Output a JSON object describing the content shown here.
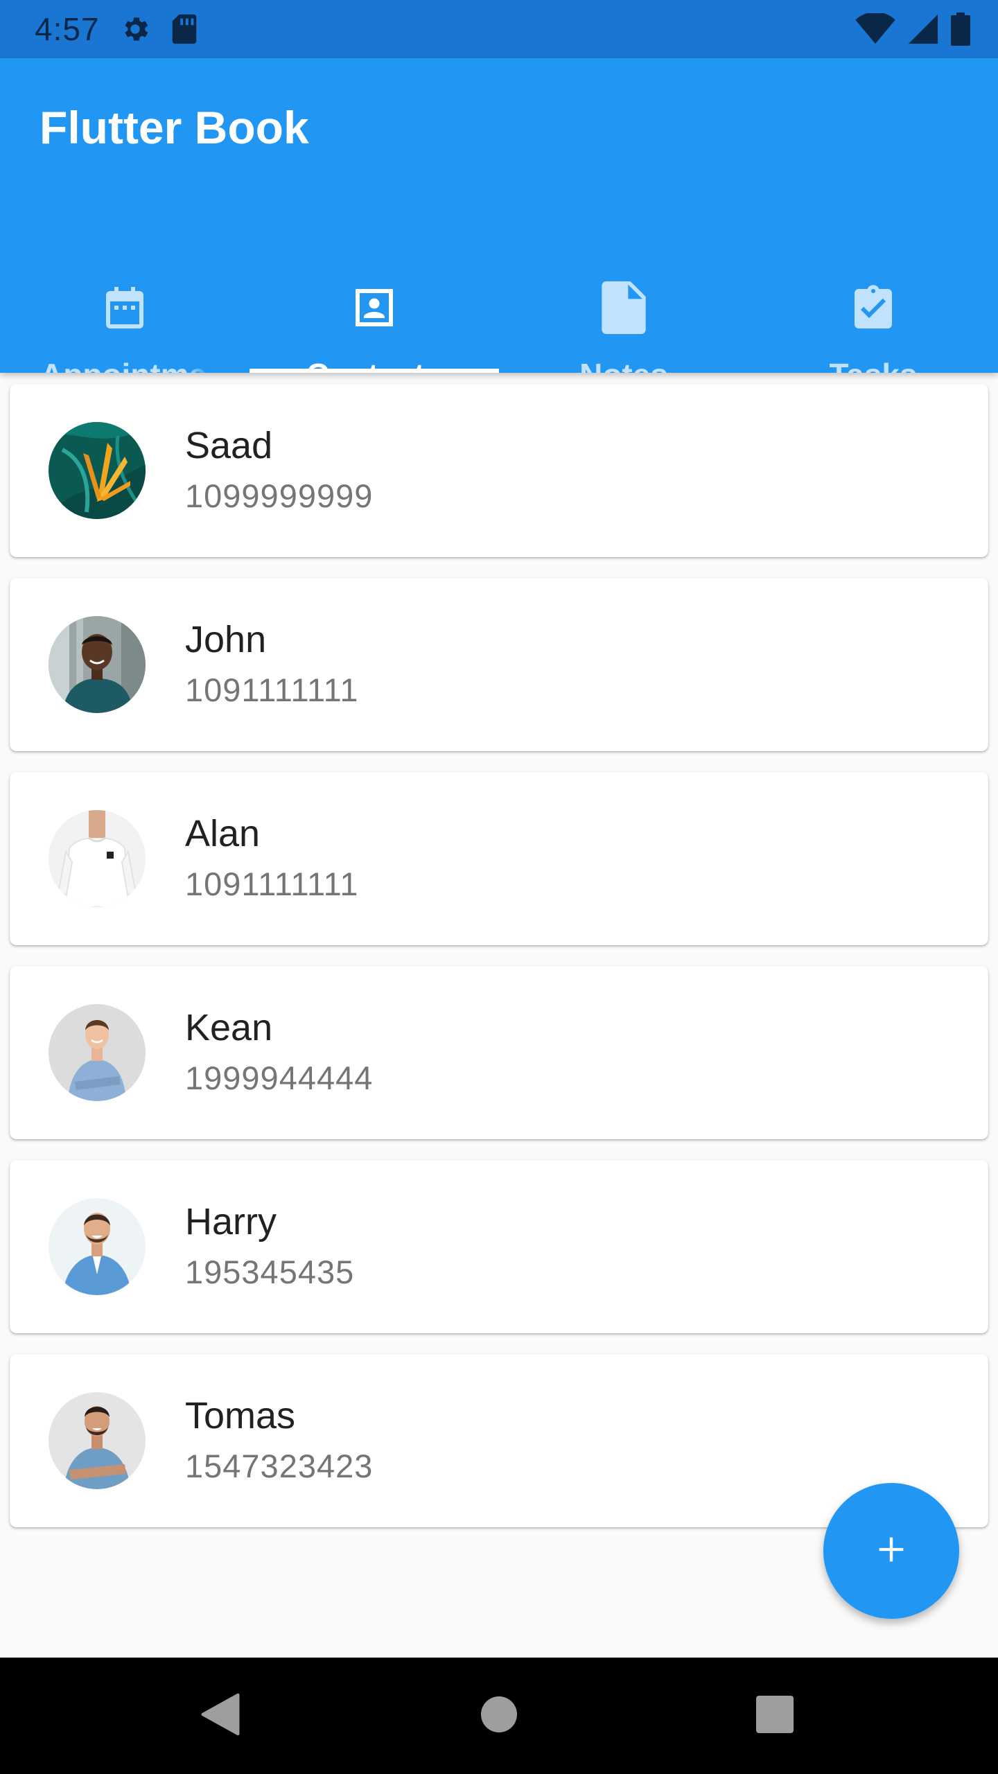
{
  "status_bar": {
    "time": "4:57",
    "icons": [
      "gear-icon",
      "sd-card-icon",
      "wifi-icon",
      "cellular-signal-icon",
      "battery-icon"
    ],
    "background": "#1976d2"
  },
  "app_bar": {
    "title": "Flutter Book",
    "background": "#2196f3"
  },
  "tabs": [
    {
      "label": "Appointments",
      "icon": "calendar-icon",
      "active": false
    },
    {
      "label": "Contacts",
      "icon": "contact-card-icon",
      "active": true
    },
    {
      "label": "Notes",
      "icon": "note-icon",
      "active": false
    },
    {
      "label": "Tasks",
      "icon": "clipboard-check-icon",
      "active": false
    }
  ],
  "contacts": [
    {
      "name": "Saad",
      "phone": "1099999999",
      "avatar": "tropical-leaf-photo"
    },
    {
      "name": "John",
      "phone": "1091111111",
      "avatar": "man-green-sweater-photo"
    },
    {
      "name": "Alan",
      "phone": "1091111111",
      "avatar": "man-white-tshirt-photo"
    },
    {
      "name": "Kean",
      "phone": "1999944444",
      "avatar": "man-denim-shirt-photo"
    },
    {
      "name": "Harry",
      "phone": "195345435",
      "avatar": "man-blue-shirt-photo"
    },
    {
      "name": "Tomas",
      "phone": "1547323423",
      "avatar": "man-blue-tshirt-photo"
    }
  ],
  "fab": {
    "icon": "add-icon",
    "color": "#2196f3"
  },
  "nav_bar": {
    "icons": [
      "back-icon",
      "home-icon",
      "recents-icon"
    ]
  }
}
